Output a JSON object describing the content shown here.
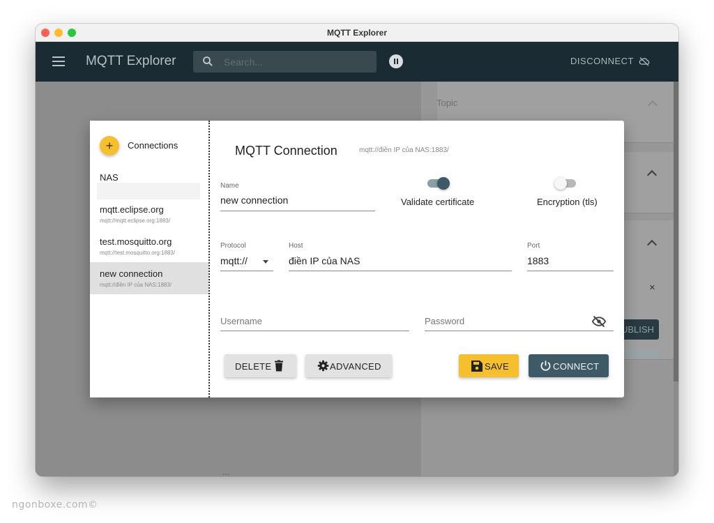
{
  "window": {
    "title": "MQTT Explorer"
  },
  "appbar": {
    "app_title": "MQTT Explorer",
    "search_placeholder": "Search...",
    "disconnect_label": "DISCONNECT"
  },
  "background": {
    "topic_label": "Topic",
    "publish_label": "UBLISH",
    "close_char": "×",
    "dots": "..."
  },
  "connections": {
    "add_symbol": "+",
    "header": "Connections",
    "items": [
      {
        "name": "NAS",
        "url": ""
      },
      {
        "name": "mqtt.eclipse.org",
        "url": "mqtt://mqtt.eclipse.org:1883/"
      },
      {
        "name": "test.mosquitto.org",
        "url": "mqtt://test.mosquitto.org:1883/"
      },
      {
        "name": "new connection",
        "url": "mqtt://điền IP của NAS:1883/",
        "selected": true
      }
    ]
  },
  "form": {
    "title": "MQTT Connection",
    "subtitle": "mqtt://điền IP của NAS:1883/",
    "name_label": "Name",
    "name_value": "new connection",
    "validate_label": "Validate certificate",
    "validate_on": true,
    "encryption_label": "Encryption (tls)",
    "encryption_on": false,
    "protocol_label": "Protocol",
    "protocol_value": "mqtt://",
    "host_label": "Host",
    "host_value": "điền IP của NAS",
    "port_label": "Port",
    "port_value": "1883",
    "username_placeholder": "Username",
    "password_placeholder": "Password"
  },
  "buttons": {
    "delete": "DELETE",
    "advanced": "ADVANCED",
    "save": "SAVE",
    "connect": "CONNECT"
  },
  "colors": {
    "appbar": "#1a2b33",
    "accent_yellow": "#f5bf2d",
    "connect_button": "#3d5a66",
    "toggle_on": "#3d5a66"
  },
  "watermark": "ngonboxe.com©"
}
